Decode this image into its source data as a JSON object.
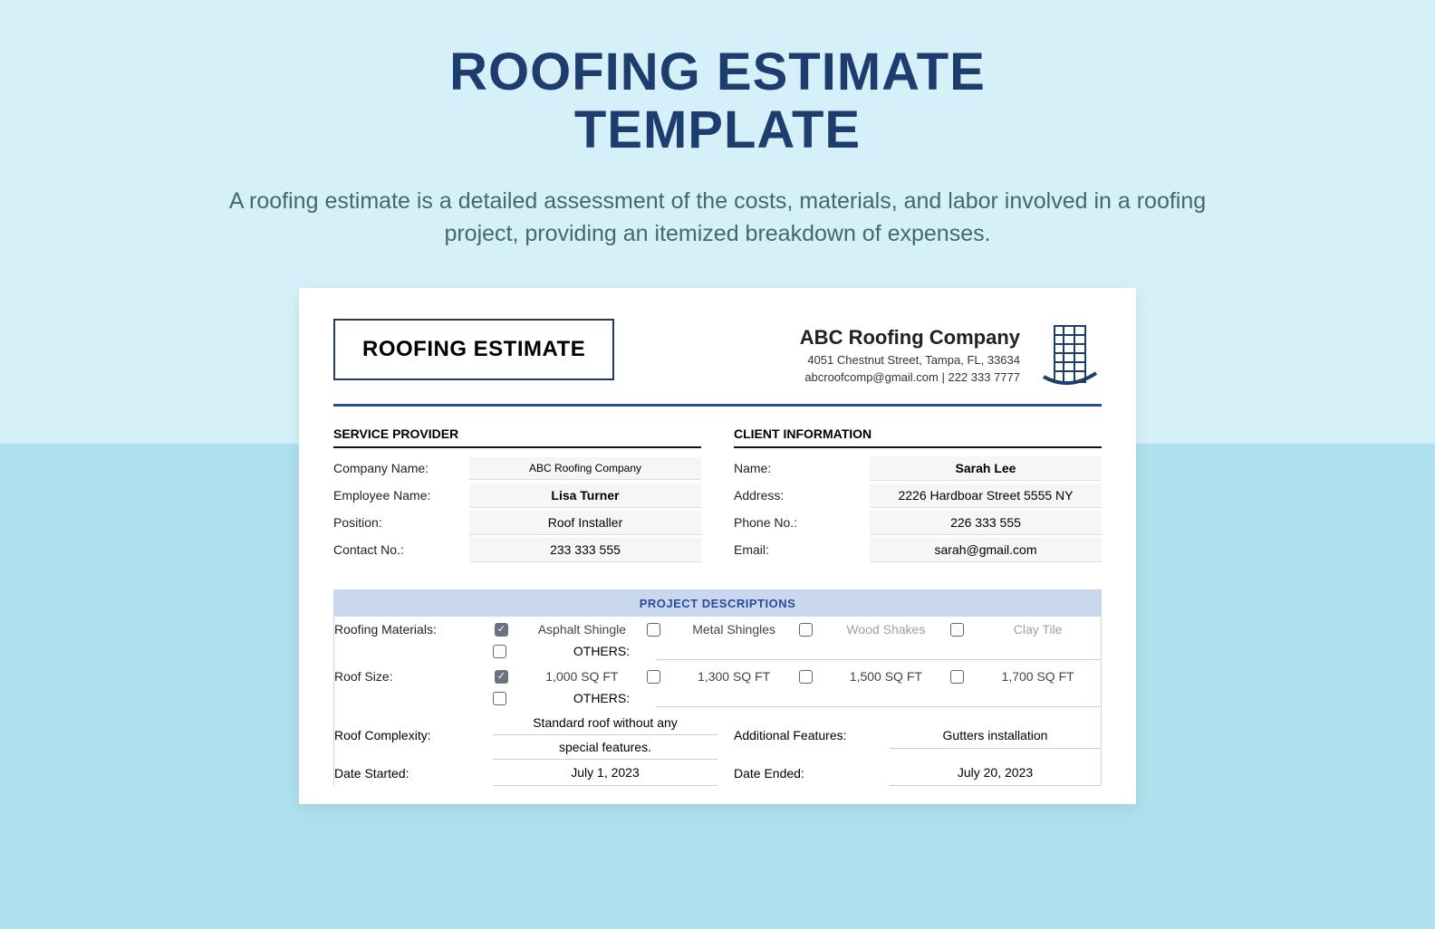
{
  "hero": {
    "title_line1": "ROOFING ESTIMATE",
    "title_line2": "TEMPLATE",
    "description": "A roofing estimate is a detailed assessment of the costs, materials, and labor involved in a roofing project, providing an itemized breakdown of expenses."
  },
  "document": {
    "box_title": "ROOFING ESTIMATE",
    "company": {
      "name": "ABC Roofing Company",
      "address": "4051 Chestnut Street, Tampa, FL, 33634",
      "contact": "abcroofcomp@gmail.com | 222 333 7777"
    },
    "provider_title": "SERVICE PROVIDER",
    "provider": {
      "company_label": "Company Name:",
      "company_value": "ABC Roofing Company",
      "employee_label": "Employee Name:",
      "employee_value": "Lisa Turner",
      "position_label": "Position:",
      "position_value": "Roof Installer",
      "contact_label": "Contact No.:",
      "contact_value": "233 333 555"
    },
    "client_title": "CLIENT INFORMATION",
    "client": {
      "name_label": "Name:",
      "name_value": "Sarah Lee",
      "address_label": "Address:",
      "address_value": "2226 Hardboar Street 5555 NY",
      "phone_label": "Phone No.:",
      "phone_value": "226 333 555",
      "email_label": "Email:",
      "email_value": "sarah@gmail.com"
    },
    "project_title": "PROJECT DESCRIPTIONS",
    "materials_label": "Roofing Materials:",
    "materials": [
      "Asphalt Shingle",
      "Metal Shingles",
      "Wood Shakes",
      "Clay Tile"
    ],
    "others_label": "OTHERS:",
    "size_label": "Roof Size:",
    "sizes": [
      "1,000 SQ FT",
      "1,300 SQ FT",
      "1,500 SQ FT",
      "1,700 SQ FT"
    ],
    "complexity_label": "Roof Complexity:",
    "complexity_value1": "Standard roof without any",
    "complexity_value2": "special features.",
    "addl_label": "Additional Features:",
    "addl_value": "Gutters installation",
    "date_start_label": "Date Started:",
    "date_start_value": "July 1, 2023",
    "date_end_label": "Date Ended:",
    "date_end_value": "July 20, 2023"
  }
}
